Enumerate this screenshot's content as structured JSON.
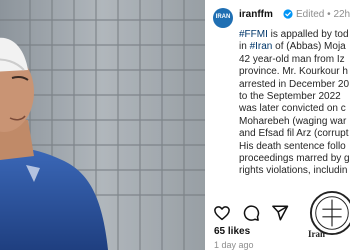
{
  "post": {
    "username": "iranffm",
    "avatar_text": "IRAN",
    "edited_label": "Edited",
    "separator": "•",
    "time_ago": "22h",
    "caption_lines": [
      {
        "tag": "#FFMI",
        "text": " is appalled by tod"
      },
      {
        "pre": "in ",
        "tag": "#Iran",
        "text": " of (Abbas) Moja"
      },
      {
        "text": "42 year-old man from Iz"
      },
      {
        "text": "province. Mr. Kourkour h"
      },
      {
        "text": "arrested in December 20"
      },
      {
        "text": "to the September 2022 "
      },
      {
        "text": "was later convicted on c"
      },
      {
        "text": "Moharebeh (waging war"
      },
      {
        "text": "and Efsad fil Arz (corrupt"
      },
      {
        "text": "His death sentence follo"
      },
      {
        "text": "proceedings marred by g"
      },
      {
        "text": "rights violations, includin"
      }
    ],
    "likes": "65 likes",
    "date": "1 day ago",
    "watermark_text": "Iran"
  },
  "icons": {
    "verified": "verified-badge-icon",
    "like": "heart-icon",
    "comment": "comment-icon",
    "share": "share-icon",
    "save": "bookmark-icon"
  },
  "colors": {
    "hashtag": "#00376b",
    "verified": "#0095f6",
    "avatar": "#1f6fb3",
    "shirt": "#2f5aa8"
  }
}
